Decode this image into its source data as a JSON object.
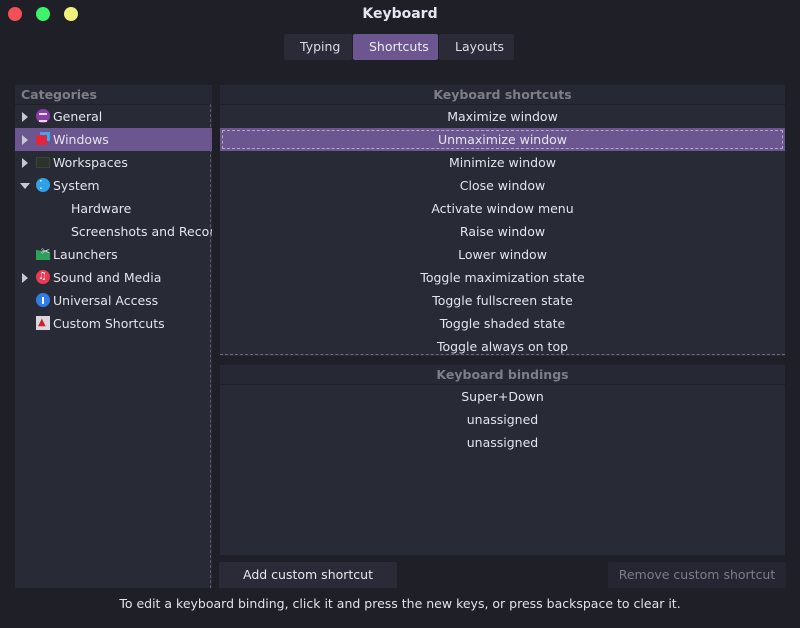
{
  "window": {
    "title": "Keyboard",
    "controls": [
      "close",
      "maximize",
      "minimize"
    ]
  },
  "tabs": [
    {
      "label": "Typing",
      "active": false
    },
    {
      "label": "Shortcuts",
      "active": true
    },
    {
      "label": "Layouts",
      "active": false
    }
  ],
  "categories": {
    "header": "Categories",
    "items": [
      {
        "label": "General",
        "icon": "keyboard-icon",
        "expander": "collapsed",
        "selected": false
      },
      {
        "label": "Windows",
        "icon": "windows-icon",
        "expander": "collapsed",
        "selected": true
      },
      {
        "label": "Workspaces",
        "icon": "workspaces-icon",
        "expander": "collapsed",
        "selected": false
      },
      {
        "label": "System",
        "icon": "system-icon",
        "expander": "expanded",
        "selected": false
      },
      {
        "label": "Hardware",
        "child": true
      },
      {
        "label": "Screenshots and Recordings",
        "child": true
      },
      {
        "label": "Launchers",
        "icon": "launchers-icon",
        "selected": false
      },
      {
        "label": "Sound and Media",
        "icon": "sound-icon",
        "expander": "collapsed",
        "selected": false
      },
      {
        "label": "Universal Access",
        "icon": "universal-access-icon",
        "selected": false
      },
      {
        "label": "Custom Shortcuts",
        "icon": "custom-shortcuts-icon",
        "selected": false
      }
    ]
  },
  "shortcuts": {
    "header": "Keyboard shortcuts",
    "items": [
      "Maximize window",
      "Unmaximize window",
      "Minimize window",
      "Close window",
      "Activate window menu",
      "Raise window",
      "Lower window",
      "Toggle maximization state",
      "Toggle fullscreen state",
      "Toggle shaded state",
      "Toggle always on top"
    ],
    "selected_index": 1
  },
  "bindings": {
    "header": "Keyboard bindings",
    "items": [
      "Super+Down",
      "unassigned",
      "unassigned"
    ]
  },
  "buttons": {
    "add": "Add custom shortcut",
    "remove": "Remove custom shortcut"
  },
  "hint": "To edit a keyboard binding, click it and press the new keys, or press backspace to clear it.",
  "colors": {
    "accent": "#6c5690",
    "background": "#1f1f28",
    "panel": "#282a35"
  }
}
